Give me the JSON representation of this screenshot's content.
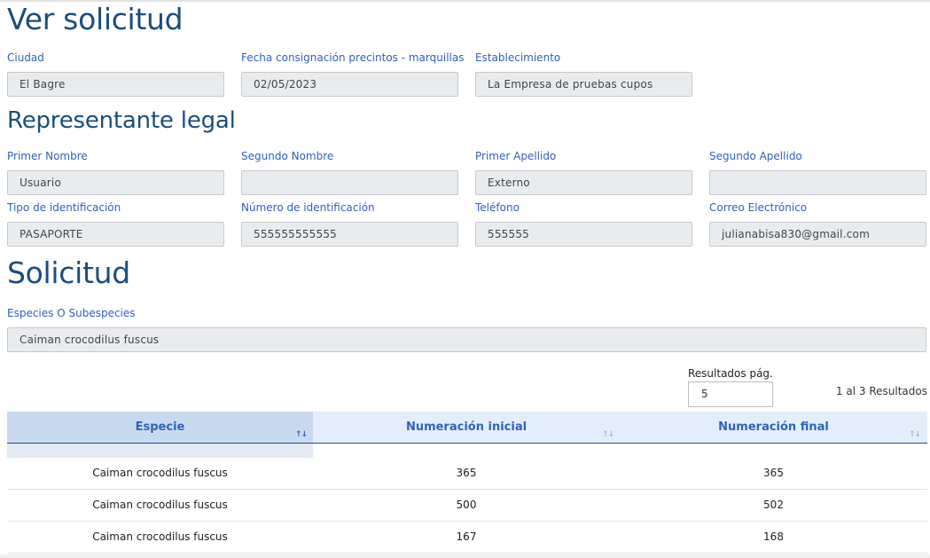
{
  "page": {
    "title": "Ver solicitud",
    "fields_top": [
      {
        "label": "Ciudad",
        "value": "El Bagre"
      },
      {
        "label": "Fecha consignación precintos - marquillas",
        "value": "02/05/2023"
      },
      {
        "label": "Establecimiento",
        "value": "La Empresa de pruebas cupos"
      }
    ]
  },
  "representante": {
    "title": "Representante legal",
    "row1": [
      {
        "label": "Primer Nombre",
        "value": "Usuario"
      },
      {
        "label": "Segundo Nombre",
        "value": ""
      },
      {
        "label": "Primer Apellido",
        "value": "Externo"
      },
      {
        "label": "Segundo Apellido",
        "value": ""
      }
    ],
    "row2": [
      {
        "label": "Tipo de identificación",
        "value": "PASAPORTE"
      },
      {
        "label": "Número de identificación",
        "value": "555555555555"
      },
      {
        "label": "Teléfono",
        "value": "555555"
      },
      {
        "label": "Correo Electrónico",
        "value": "julianabisa830@gmail.com"
      }
    ]
  },
  "solicitud": {
    "title": "Solicitud",
    "especies_label": "Especies O Subespecies",
    "especies_value": "Caiman crocodilus fuscus"
  },
  "pagination": {
    "label": "Resultados pág.",
    "value": "5",
    "count": "1 al 3 Resultados"
  },
  "table": {
    "headers": [
      "Especie",
      "Numeración inicial",
      "Numeración final"
    ],
    "sort_icons": [
      "↑↓",
      "↑↓",
      "↑↓"
    ],
    "rows": [
      [
        "Caiman crocodilus fuscus",
        "365",
        "365"
      ],
      [
        "Caiman crocodilus fuscus",
        "500",
        "502"
      ],
      [
        "Caiman crocodilus fuscus",
        "167",
        "168"
      ]
    ]
  }
}
